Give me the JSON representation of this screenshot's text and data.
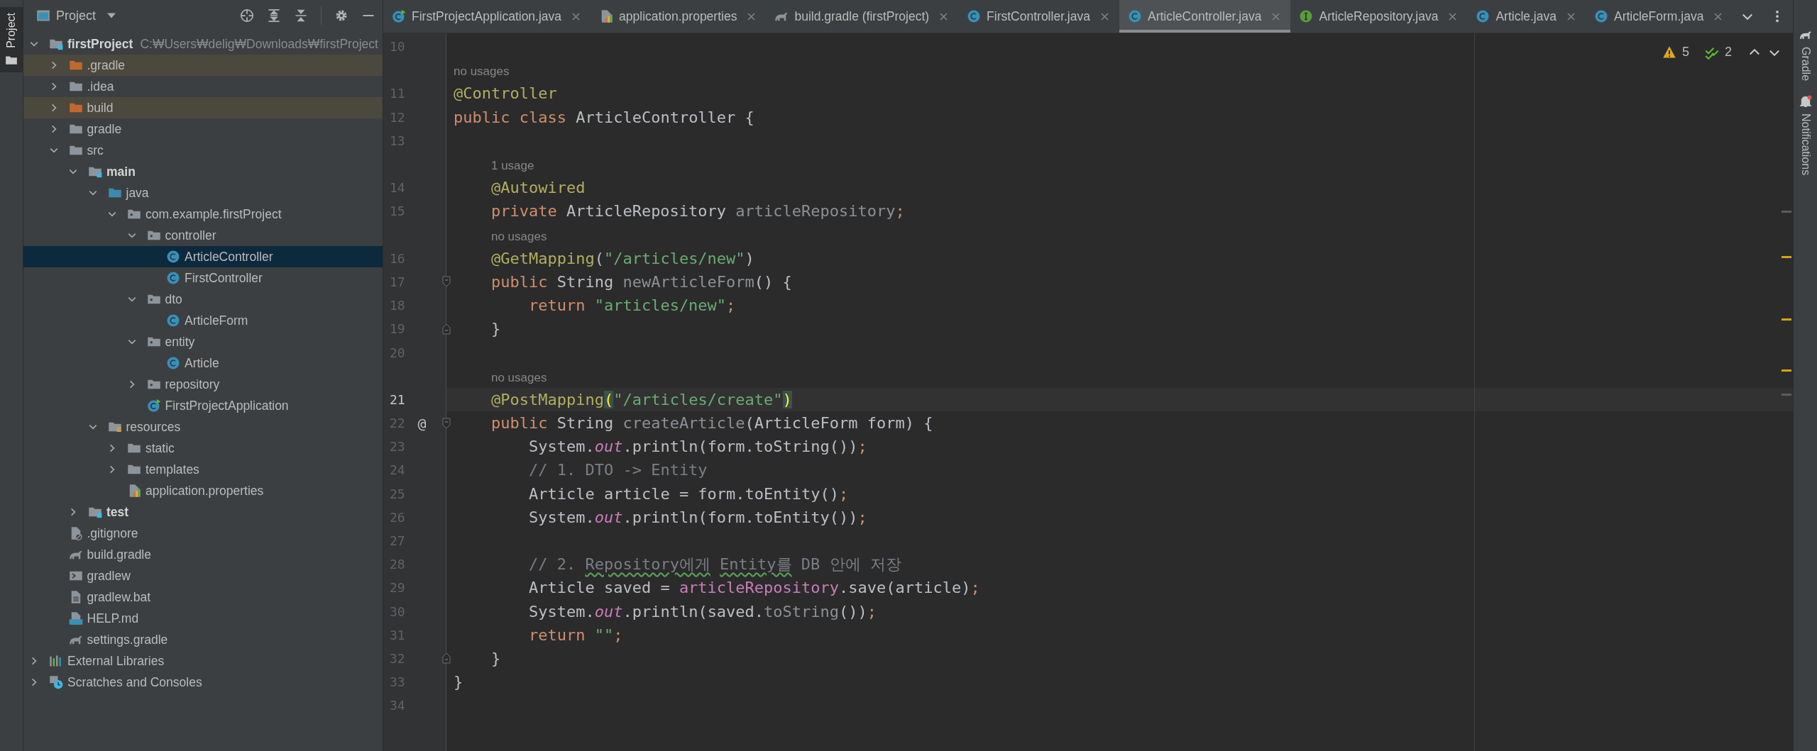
{
  "left_strip": {
    "tabs": [
      {
        "label": "Project",
        "selected": true
      }
    ]
  },
  "project_panel": {
    "title": "Project",
    "tree": [
      {
        "name": "firstProject",
        "kind": "module",
        "path": "C:₩Users₩delig₩Downloads₩firstProject",
        "expanded": true,
        "selected": false,
        "children": [
          {
            "name": ".gradle",
            "kind": "excluded-folder",
            "expanded": false,
            "selected": false
          },
          {
            "name": ".idea",
            "kind": "folder",
            "expanded": false,
            "selected": false
          },
          {
            "name": "build",
            "kind": "excluded-folder",
            "expanded": false,
            "selected": false
          },
          {
            "name": "gradle",
            "kind": "folder",
            "expanded": false,
            "selected": false
          },
          {
            "name": "src",
            "kind": "folder",
            "expanded": true,
            "selected": false,
            "children": [
              {
                "name": "main",
                "kind": "module",
                "expanded": true,
                "selected": false,
                "children": [
                  {
                    "name": "java",
                    "kind": "source-folder",
                    "expanded": true,
                    "selected": false,
                    "children": [
                      {
                        "name": "com.example.firstProject",
                        "kind": "package",
                        "expanded": true,
                        "selected": false,
                        "children": [
                          {
                            "name": "controller",
                            "kind": "package",
                            "expanded": true,
                            "selected": false,
                            "children": [
                              {
                                "name": "ArticleController",
                                "kind": "class",
                                "selected": true
                              },
                              {
                                "name": "FirstController",
                                "kind": "class",
                                "selected": false
                              }
                            ]
                          },
                          {
                            "name": "dto",
                            "kind": "package",
                            "expanded": true,
                            "selected": false,
                            "children": [
                              {
                                "name": "ArticleForm",
                                "kind": "class",
                                "selected": false
                              }
                            ]
                          },
                          {
                            "name": "entity",
                            "kind": "package",
                            "expanded": true,
                            "selected": false,
                            "children": [
                              {
                                "name": "Article",
                                "kind": "class",
                                "selected": false
                              }
                            ]
                          },
                          {
                            "name": "repository",
                            "kind": "package",
                            "expanded": false,
                            "selected": false
                          },
                          {
                            "name": "FirstProjectApplication",
                            "kind": "app-class",
                            "selected": false
                          }
                        ]
                      }
                    ]
                  },
                  {
                    "name": "resources",
                    "kind": "resources",
                    "expanded": true,
                    "selected": false,
                    "children": [
                      {
                        "name": "static",
                        "kind": "folder",
                        "expanded": false,
                        "selected": false
                      },
                      {
                        "name": "templates",
                        "kind": "folder",
                        "expanded": false,
                        "selected": false
                      },
                      {
                        "name": "application.properties",
                        "kind": "properties",
                        "selected": false
                      }
                    ]
                  }
                ]
              },
              {
                "name": "test",
                "kind": "module",
                "expanded": false,
                "selected": false
              }
            ]
          },
          {
            "name": ".gitignore",
            "kind": "gitignore",
            "selected": false
          },
          {
            "name": "build.gradle",
            "kind": "gradle",
            "selected": false
          },
          {
            "name": "gradlew",
            "kind": "shell",
            "selected": false
          },
          {
            "name": "gradlew.bat",
            "kind": "bat",
            "selected": false
          },
          {
            "name": "HELP.md",
            "kind": "markdown",
            "selected": false
          },
          {
            "name": "settings.gradle",
            "kind": "gradle",
            "selected": false
          }
        ]
      },
      {
        "name": "External Libraries",
        "kind": "libraries",
        "expanded": false,
        "selected": false
      },
      {
        "name": "Scratches and Consoles",
        "kind": "scratches",
        "expanded": false,
        "selected": false
      }
    ]
  },
  "tabs": [
    {
      "label": "FirstProjectApplication.java",
      "kind": "app-class",
      "selected": false
    },
    {
      "label": "application.properties",
      "kind": "properties",
      "selected": false
    },
    {
      "label": "build.gradle (firstProject)",
      "kind": "gradle",
      "selected": false
    },
    {
      "label": "FirstController.java",
      "kind": "class",
      "selected": false
    },
    {
      "label": "ArticleController.java",
      "kind": "class",
      "selected": true
    },
    {
      "label": "ArticleRepository.java",
      "kind": "interface",
      "selected": false
    },
    {
      "label": "Article.java",
      "kind": "class",
      "selected": false
    },
    {
      "label": "ArticleForm.java",
      "kind": "class",
      "selected": false
    }
  ],
  "inspections": [
    {
      "kind": "warning",
      "count": "5"
    },
    {
      "kind": "weak",
      "count": "2"
    }
  ],
  "editor": {
    "lines": [
      {
        "kind": "code",
        "number": "10",
        "current": false,
        "fold_start": false,
        "fold_end": false
      },
      {
        "kind": "hint",
        "text": "no usages"
      },
      {
        "kind": "code",
        "number": "11",
        "current": false,
        "fold_start": false,
        "fold_end": false,
        "tokens": [
          {
            "kind": "ann",
            "text": "@Controller"
          }
        ]
      },
      {
        "kind": "code",
        "number": "12",
        "current": false,
        "fold_start": false,
        "fold_end": false,
        "tokens": [
          {
            "kind": "kw",
            "text": "public class"
          },
          {
            "kind": "plain",
            "text": " ArticleController {"
          }
        ]
      },
      {
        "kind": "code",
        "number": "13",
        "current": false,
        "fold_start": false,
        "fold_end": false
      },
      {
        "kind": "hint",
        "text": "    1 usage"
      },
      {
        "kind": "code",
        "number": "14",
        "current": false,
        "fold_start": false,
        "fold_end": false,
        "tokens": [
          {
            "kind": "ann",
            "text": "    @Autowired"
          }
        ]
      },
      {
        "kind": "code",
        "number": "15",
        "current": false,
        "fold_start": false,
        "fold_end": false,
        "tokens": [
          {
            "kind": "kw",
            "text": "    private"
          },
          {
            "kind": "type",
            "text": " ArticleRepository"
          },
          {
            "kind": "unused",
            "text": " articleRepository"
          },
          {
            "kind": "punct",
            "text": ";"
          }
        ]
      },
      {
        "kind": "hint",
        "text": "    no usages"
      },
      {
        "kind": "code",
        "number": "16",
        "current": false,
        "fold_start": false,
        "fold_end": false,
        "tokens": [
          {
            "kind": "ann",
            "text": "    @GetMapping"
          },
          {
            "kind": "plain",
            "text": "("
          },
          {
            "kind": "str",
            "text": "\"/articles/new\""
          },
          {
            "kind": "plain",
            "text": ")"
          }
        ]
      },
      {
        "kind": "code",
        "number": "17",
        "current": false,
        "fold_start": true,
        "fold_end": false,
        "tokens": [
          {
            "kind": "kw",
            "text": "    public"
          },
          {
            "kind": "type",
            "text": " String"
          },
          {
            "kind": "unused",
            "text": " newArticleForm"
          },
          {
            "kind": "plain",
            "text": "() {"
          }
        ]
      },
      {
        "kind": "code",
        "number": "18",
        "current": false,
        "fold_start": false,
        "fold_end": false,
        "tokens": [
          {
            "kind": "kw",
            "text": "        return"
          },
          {
            "kind": "str",
            "text": " \"articles/new\""
          },
          {
            "kind": "punct",
            "text": ";"
          }
        ]
      },
      {
        "kind": "code",
        "number": "19",
        "current": false,
        "fold_start": false,
        "fold_end": true,
        "tokens": [
          {
            "kind": "plain",
            "text": "    }"
          }
        ]
      },
      {
        "kind": "code",
        "number": "20",
        "current": false,
        "fold_start": false,
        "fold_end": false
      },
      {
        "kind": "hint",
        "text": "    no usages"
      },
      {
        "kind": "code",
        "number": "21",
        "current": true,
        "fold_start": false,
        "fold_end": false,
        "tokens": [
          {
            "kind": "ann",
            "text": "    @PostMapping"
          },
          {
            "kind": "match",
            "text": "("
          },
          {
            "kind": "str",
            "text": "\"/articles/create\""
          },
          {
            "kind": "match",
            "text": ")"
          }
        ]
      },
      {
        "kind": "code",
        "number": "22",
        "current": false,
        "fold_start": true,
        "fold_end": false,
        "gutter_icon": "@",
        "tokens": [
          {
            "kind": "kw",
            "text": "    public"
          },
          {
            "kind": "type",
            "text": " String"
          },
          {
            "kind": "unused",
            "text": " createArticle"
          },
          {
            "kind": "plain",
            "text": "(ArticleForm form) {"
          }
        ]
      },
      {
        "kind": "code",
        "number": "23",
        "current": false,
        "fold_start": false,
        "fold_end": false,
        "tokens": [
          {
            "kind": "plain",
            "text": "        System."
          },
          {
            "kind": "static",
            "text": "out"
          },
          {
            "kind": "plain",
            "text": ".println(form.toString())"
          },
          {
            "kind": "punct",
            "text": ";"
          }
        ]
      },
      {
        "kind": "code",
        "number": "24",
        "current": false,
        "fold_start": false,
        "fold_end": false,
        "tokens": [
          {
            "kind": "cmt",
            "text": "        // 1. DTO -> Entity"
          }
        ]
      },
      {
        "kind": "code",
        "number": "25",
        "current": false,
        "fold_start": false,
        "fold_end": false,
        "tokens": [
          {
            "kind": "plain",
            "text": "        Article article = form.toEntity()"
          },
          {
            "kind": "punct",
            "text": ";"
          }
        ]
      },
      {
        "kind": "code",
        "number": "26",
        "current": false,
        "fold_start": false,
        "fold_end": false,
        "tokens": [
          {
            "kind": "plain",
            "text": "        System."
          },
          {
            "kind": "static",
            "text": "out"
          },
          {
            "kind": "plain",
            "text": ".println(form.toEntity())"
          },
          {
            "kind": "punct",
            "text": ";"
          }
        ]
      },
      {
        "kind": "code",
        "number": "27",
        "current": false,
        "fold_start": false,
        "fold_end": false
      },
      {
        "kind": "code",
        "number": "28",
        "current": false,
        "fold_start": false,
        "fold_end": false,
        "tokens": [
          {
            "kind": "cmt",
            "text": "        // 2."
          },
          {
            "kind": "typo",
            "text": " Repository에게"
          },
          {
            "kind": "typo",
            "text": " Entity를"
          },
          {
            "kind": "cmt",
            "text": " DB 안에 저장"
          }
        ]
      },
      {
        "kind": "code",
        "number": "29",
        "current": false,
        "fold_start": false,
        "fold_end": false,
        "tokens": [
          {
            "kind": "plain",
            "text": "        Article saved ="
          },
          {
            "kind": "member",
            "text": " articleRepository"
          },
          {
            "kind": "plain",
            "text": ".save(article)"
          },
          {
            "kind": "punct",
            "text": ";"
          }
        ]
      },
      {
        "kind": "code",
        "number": "30",
        "current": false,
        "fold_start": false,
        "fold_end": false,
        "tokens": [
          {
            "kind": "plain",
            "text": "        System."
          },
          {
            "kind": "static",
            "text": "out"
          },
          {
            "kind": "plain",
            "text": ".println(saved."
          },
          {
            "kind": "unused",
            "text": "toString"
          },
          {
            "kind": "plain",
            "text": "())"
          },
          {
            "kind": "punct",
            "text": ";"
          }
        ]
      },
      {
        "kind": "code",
        "number": "31",
        "current": false,
        "fold_start": false,
        "fold_end": false,
        "tokens": [
          {
            "kind": "kw",
            "text": "        return"
          },
          {
            "kind": "str",
            "text": " \"\""
          },
          {
            "kind": "punct",
            "text": ";"
          }
        ]
      },
      {
        "kind": "code",
        "number": "32",
        "current": false,
        "fold_start": false,
        "fold_end": true,
        "tokens": [
          {
            "kind": "plain",
            "text": "    }"
          }
        ]
      },
      {
        "kind": "code",
        "number": "33",
        "current": false,
        "fold_start": false,
        "fold_end": false,
        "tokens": [
          {
            "kind": "plain",
            "text": "}"
          }
        ]
      },
      {
        "kind": "code",
        "number": "34",
        "current": false,
        "fold_start": false,
        "fold_end": false
      }
    ]
  },
  "right_strip": {
    "tabs": [
      {
        "label": "Gradle",
        "kind": "gradle"
      },
      {
        "label": "Notifications",
        "kind": "notifications"
      }
    ]
  }
}
